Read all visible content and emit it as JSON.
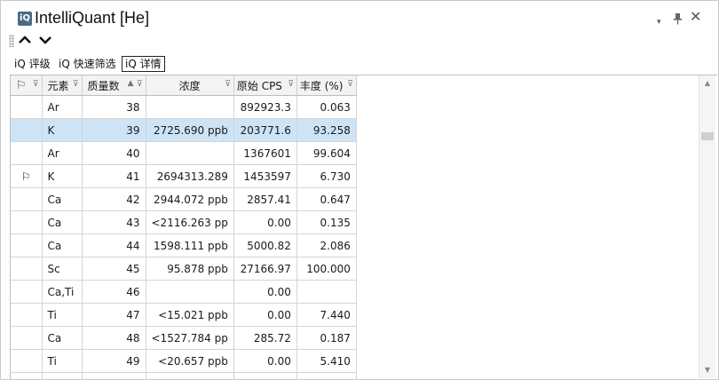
{
  "window": {
    "app_icon": "iQ",
    "title": "IntelliQuant [He]",
    "dropdown_icon": "▾",
    "pin_icon": "📌",
    "close_icon": "✕"
  },
  "nav": {
    "up_icon": "⌃",
    "down_icon": "⌄"
  },
  "tabs": [
    {
      "label": "iQ 评级"
    },
    {
      "label": "iQ 快速筛选"
    },
    {
      "label": "iQ 详情"
    }
  ],
  "grid": {
    "columns": [
      {
        "key": "flag",
        "label": ""
      },
      {
        "key": "element",
        "label": "元素"
      },
      {
        "key": "mass",
        "label": "质量数",
        "sort": "▲"
      },
      {
        "key": "conc",
        "label": "浓度"
      },
      {
        "key": "cps",
        "label": "原始 CPS"
      },
      {
        "key": "abund",
        "label": "丰度 (%)"
      }
    ],
    "rows": [
      {
        "flag": "",
        "element": "Ar",
        "mass": "38",
        "conc": "",
        "cps": "892923.3",
        "abund": "0.063"
      },
      {
        "flag": "",
        "element": "K",
        "mass": "39",
        "conc": "2725.690 ppb",
        "cps": "203771.6",
        "abund": "93.258",
        "selected": true
      },
      {
        "flag": "",
        "element": "Ar",
        "mass": "40",
        "conc": "",
        "cps": "1367601",
        "abund": "99.604"
      },
      {
        "flag": "⚐",
        "element": "K",
        "mass": "41",
        "conc": "2694313.289",
        "cps": "1453597",
        "abund": "6.730"
      },
      {
        "flag": "",
        "element": "Ca",
        "mass": "42",
        "conc": "2944.072 ppb",
        "cps": "2857.41",
        "abund": "0.647"
      },
      {
        "flag": "",
        "element": "Ca",
        "mass": "43",
        "conc": "<2116.263 pp",
        "cps": "0.00",
        "abund": "0.135"
      },
      {
        "flag": "",
        "element": "Ca",
        "mass": "44",
        "conc": "1598.111 ppb",
        "cps": "5000.82",
        "abund": "2.086"
      },
      {
        "flag": "",
        "element": "Sc",
        "mass": "45",
        "conc": "95.878 ppb",
        "cps": "27166.97",
        "abund": "100.000"
      },
      {
        "flag": "",
        "element": "Ca,Ti",
        "mass": "46",
        "conc": "",
        "cps": "0.00",
        "abund": ""
      },
      {
        "flag": "",
        "element": "Ti",
        "mass": "47",
        "conc": "<15.021 ppb",
        "cps": "0.00",
        "abund": "7.440"
      },
      {
        "flag": "",
        "element": "Ca",
        "mass": "48",
        "conc": "<1527.784 pp",
        "cps": "285.72",
        "abund": "0.187"
      },
      {
        "flag": "",
        "element": "Ti",
        "mass": "49",
        "conc": "<20.657 ppb",
        "cps": "0.00",
        "abund": "5.410"
      },
      {
        "flag": "",
        "element": "",
        "mass": "",
        "conc": "",
        "cps": "",
        "abund": ""
      }
    ]
  },
  "scrollbar": {
    "up_icon": "▲",
    "down_icon": "▼"
  }
}
